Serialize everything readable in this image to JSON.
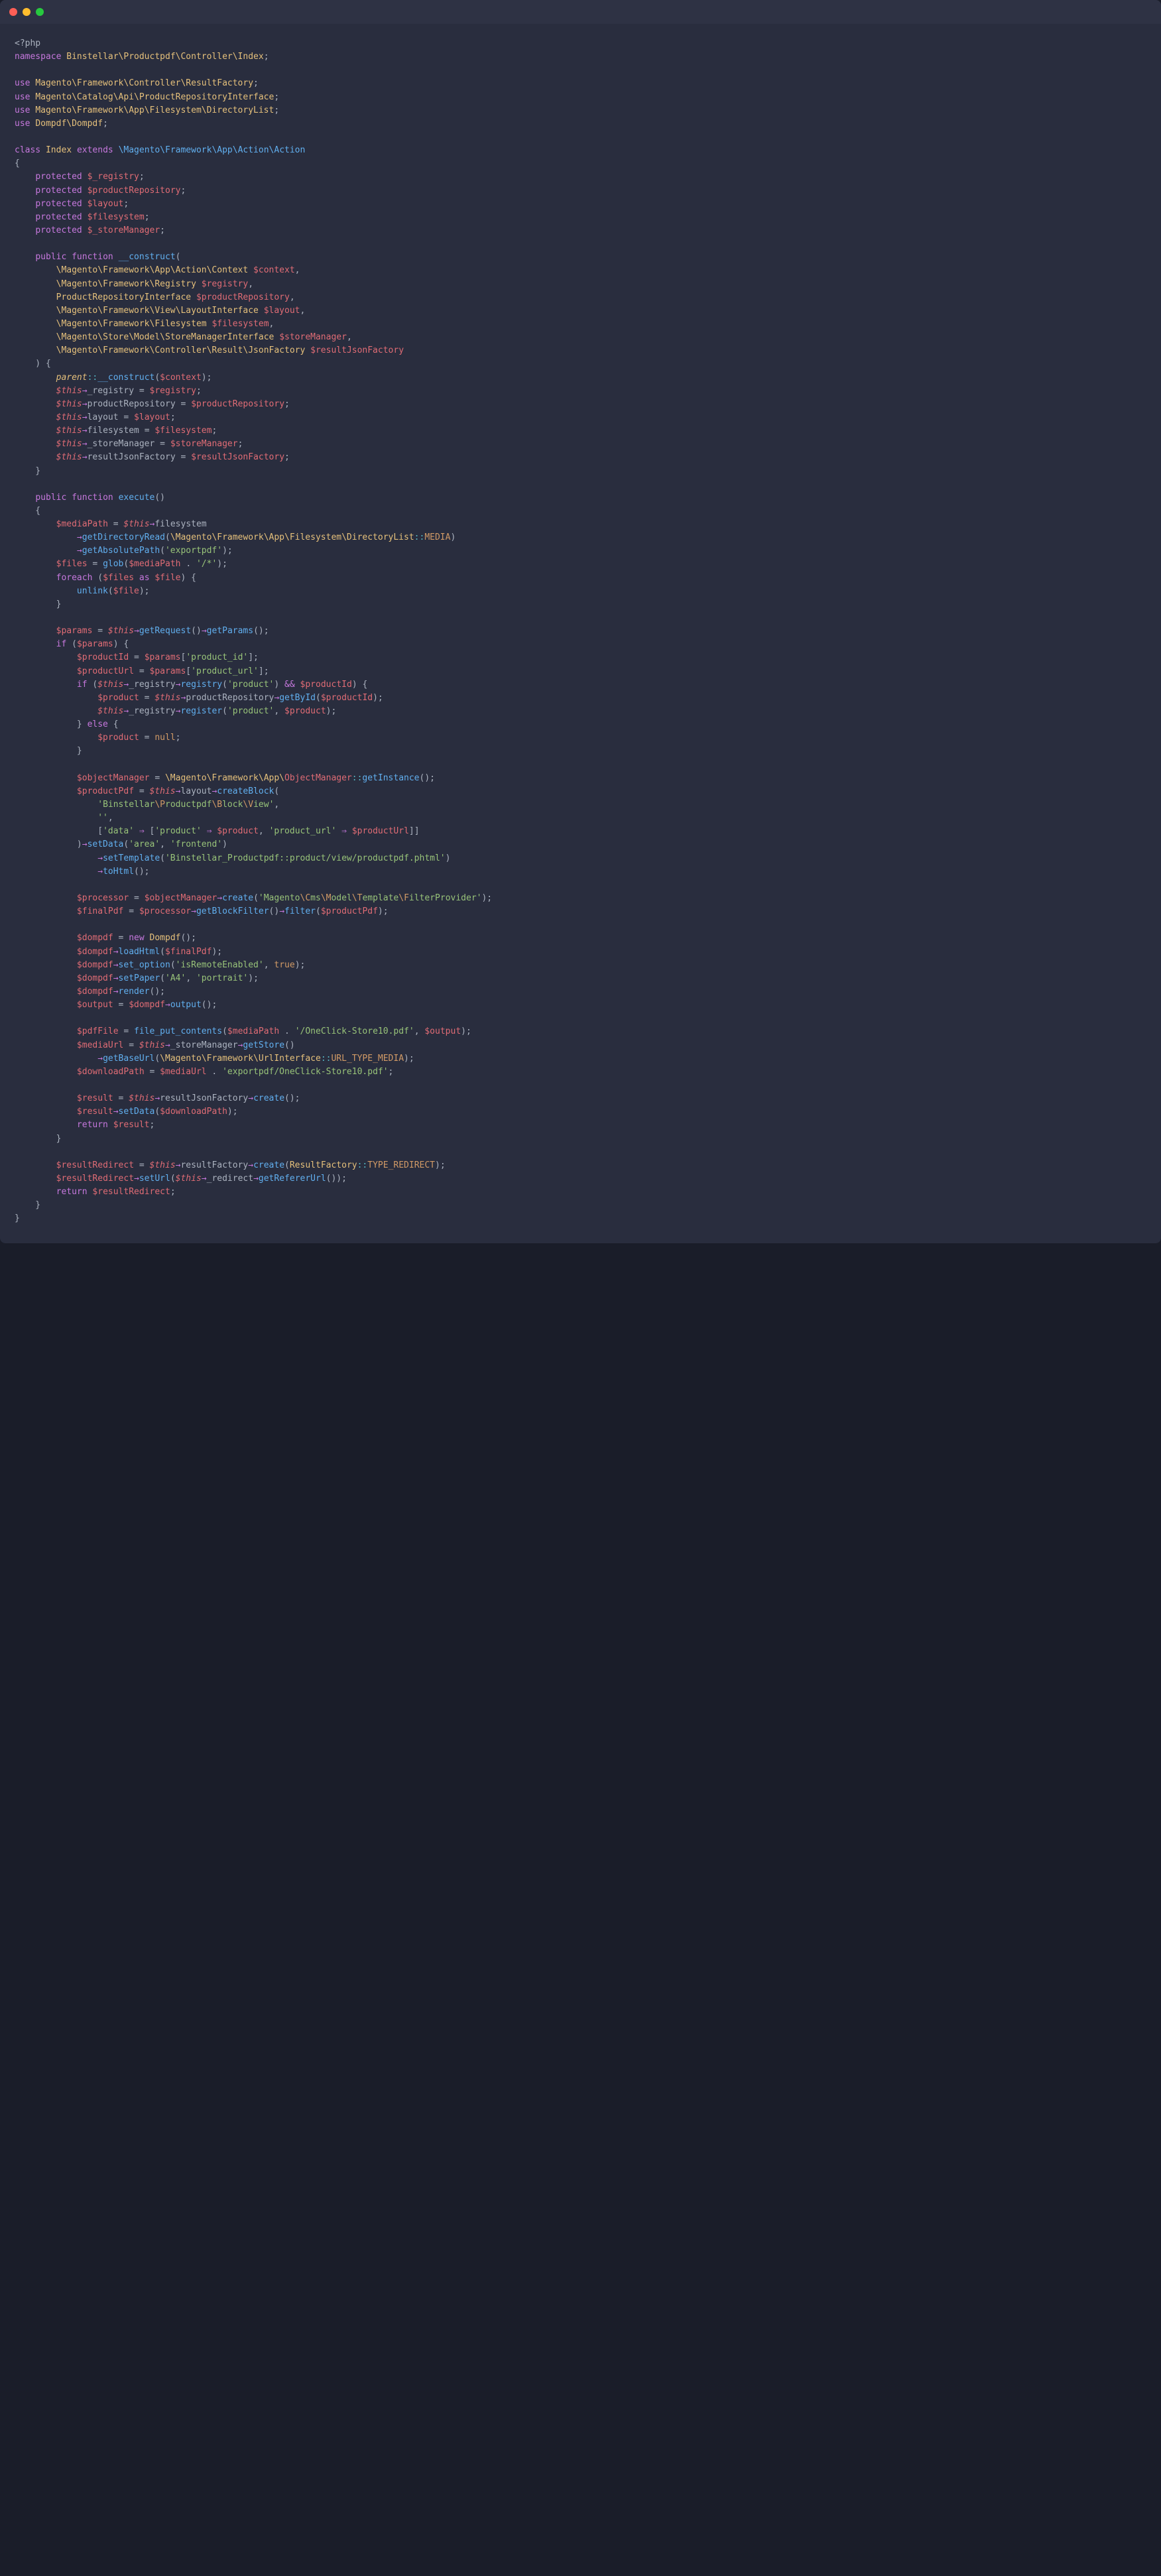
{
  "titlebar": {
    "dots": [
      "close",
      "minimize",
      "maximize"
    ]
  },
  "code": {
    "open_tag": "<?php",
    "ns_kw": "namespace",
    "ns_val": "Binstellar\\Productpdf\\Controller\\Index",
    "use_kw": "use",
    "use1": "Magento\\Framework\\Controller\\ResultFactory",
    "use2": "Magento\\Catalog\\Api\\ProductRepositoryInterface",
    "use3": "Magento\\Framework\\App\\Filesystem\\DirectoryList",
    "use4": "Dompdf\\Dompdf",
    "class_kw": "class",
    "class_name": "Index",
    "extends_kw": "extends",
    "extends_val": "\\Magento\\Framework\\App\\Action\\Action",
    "protected_kw": "protected",
    "prop1": "$_registry",
    "prop2": "$productRepository",
    "prop3": "$layout",
    "prop4": "$filesystem",
    "prop5": "$_storeManager",
    "public_kw": "public",
    "function_kw": "function",
    "construct": "__construct",
    "p1_type": "\\Magento\\Framework\\App\\Action\\Context",
    "p1_var": "$context",
    "p2_type": "\\Magento\\Framework\\Registry",
    "p2_var": "$registry",
    "p3_type": "ProductRepositoryInterface",
    "p3_var": "$productRepository",
    "p4_type": "\\Magento\\Framework\\View\\LayoutInterface",
    "p4_var": "$layout",
    "p5_type": "\\Magento\\Framework\\Filesystem",
    "p5_var": "$filesystem",
    "p6_type": "\\Magento\\Store\\Model\\StoreManagerInterface",
    "p6_var": "$storeManager",
    "p7_type": "\\Magento\\Framework\\Controller\\Result\\JsonFactory",
    "p7_var": "$resultJsonFactory",
    "parent": "parent",
    "scope": "::",
    "arrow": "→",
    "this": "$this",
    "assign_registry": "_registry",
    "assign_prodrepo": "productRepository",
    "assign_layout": "layout",
    "assign_fs": "filesystem",
    "assign_sm": "_storeManager",
    "assign_rjf": "resultJsonFactory",
    "execute": "execute",
    "v_mediaPath": "$mediaPath",
    "m_filesystem": "filesystem",
    "m_getDirRead": "getDirectoryRead",
    "dirlist": "\\Magento\\Framework\\App\\Filesystem\\DirectoryList",
    "const_MEDIA": "MEDIA",
    "m_getAbsPath": "getAbsolutePath",
    "s_exportpdf": "'exportpdf'",
    "v_files": "$files",
    "f_glob": "glob",
    "s_glob": "'/*'",
    "foreach_kw": "foreach",
    "as_kw": "as",
    "v_file": "$file",
    "f_unlink": "unlink",
    "v_params": "$params",
    "m_getRequest": "getRequest",
    "m_getParams": "getParams",
    "if_kw": "if",
    "v_productId": "$productId",
    "s_product_id": "'product_id'",
    "v_productUrl": "$productUrl",
    "s_product_url": "'product_url'",
    "m_registry": "registry",
    "s_product": "'product'",
    "and": "&&",
    "v_product": "$product",
    "m_getById": "getById",
    "m_register": "register",
    "else_kw": "else",
    "null_kw": "null",
    "v_objectManager": "$objectManager",
    "om_path": "\\Magento\\Framework\\App\\",
    "om_class": "ObjectManager",
    "m_getInstance": "getInstance",
    "v_productPdf": "$productPdf",
    "m_createBlock": "createBlock",
    "s_block": "'Binstellar\\Productpdf\\Block\\View'",
    "s_block_b": "Binstellar",
    "s_block_p": "Productpdf",
    "s_block_bl": "Block",
    "s_block_v": "View",
    "s_empty": "''",
    "s_data": "'data'",
    "s_producturl2": "'product_url'",
    "fat_arrow": "⇒",
    "m_setData": "setData",
    "s_area": "'area'",
    "s_frontend": "'frontend'",
    "m_setTemplate": "setTemplate",
    "s_template": "'Binstellar_Productpdf::product/view/productpdf.phtml'",
    "m_toHtml": "toHtml",
    "v_processor": "$processor",
    "m_create": "create",
    "s_filterprov": "'Magento\\Cms\\Model\\Template\\FilterProvider'",
    "v_finalPdf": "$finalPdf",
    "m_getBlockFilter": "getBlockFilter",
    "m_filter": "filter",
    "v_dompdf": "$dompdf",
    "new_kw": "new",
    "cls_Dompdf": "Dompdf",
    "m_loadHtml": "loadHtml",
    "m_set_option": "set_option",
    "s_isRemote": "'isRemoteEnabled'",
    "true_kw": "true",
    "m_setPaper": "setPaper",
    "s_A4": "'A4'",
    "s_portrait": "'portrait'",
    "m_render": "render",
    "v_output": "$output",
    "m_output": "output",
    "v_pdfFile": "$pdfFile",
    "f_fpc": "file_put_contents",
    "s_pdfname": "'/OneClick-Store10.pdf'",
    "v_mediaUrl": "$mediaUrl",
    "m_getStore": "getStore",
    "m_getBaseUrl": "getBaseUrl",
    "urlif": "\\Magento\\Framework\\UrlInterface",
    "const_URLTYPE": "URL_TYPE_MEDIA",
    "v_downloadPath": "$downloadPath",
    "s_exportpdf2": "'exportpdf/OneClick-Store10.pdf'",
    "v_result": "$result",
    "return_kw": "return",
    "v_resultRedirect": "$resultRedirect",
    "m_resultFactory": "resultFactory",
    "cls_ResultFactory": "ResultFactory",
    "const_REDIRECT": "TYPE_REDIRECT",
    "m_setUrl": "setUrl",
    "m_redirect": "_redirect",
    "m_getRefererUrl": "getRefererUrl"
  }
}
